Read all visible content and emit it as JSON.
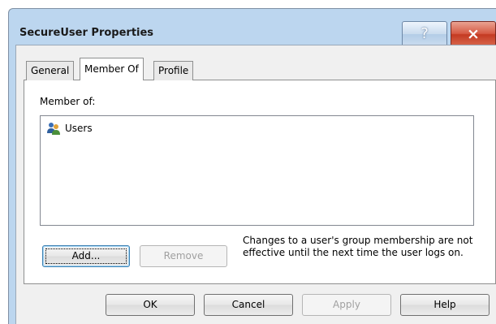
{
  "window": {
    "title": "SecureUser Properties",
    "help_glyph": "?",
    "close_glyph": "×"
  },
  "tabs": [
    {
      "label": "General",
      "active": false
    },
    {
      "label": "Member Of",
      "active": true
    },
    {
      "label": "Profile",
      "active": false
    }
  ],
  "member_of": {
    "label": "Member of:",
    "items": [
      {
        "name": "Users",
        "icon": "group-icon"
      }
    ]
  },
  "actions": {
    "add_label": "Add...",
    "remove_label": "Remove"
  },
  "note": "Changes to a user's group membership are not effective until the next time the user logs on.",
  "footer": {
    "ok_label": "OK",
    "cancel_label": "Cancel",
    "apply_label": "Apply",
    "help_label": "Help"
  },
  "colors": {
    "title_bar": "#bcd6ef",
    "close": "#c43a22",
    "client_bg": "#f0f0f0"
  }
}
